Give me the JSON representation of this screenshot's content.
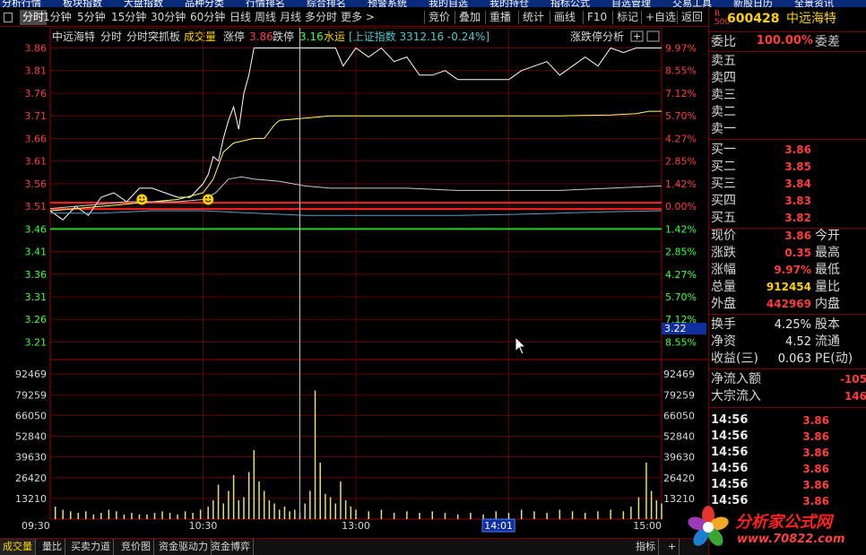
{
  "top_menu": [
    "分析行情",
    "板块指数",
    "大盘指数",
    "品种分类",
    "行情排名",
    "综合排名",
    "预警系统",
    "我的自选",
    "我的持仓",
    "指标公式",
    "自选管理",
    "交易工具",
    "新股日历",
    "全景资讯"
  ],
  "toolbar": {
    "periods": [
      "分时",
      "1分钟",
      "5分钟",
      "15分钟",
      "30分钟",
      "60分钟",
      "日线",
      "周线",
      "月线",
      "多分时",
      "更多 >"
    ],
    "actions": [
      "竞价",
      "叠加",
      "重播",
      "统计",
      "画线",
      "F10",
      "标记",
      "+自选",
      "返回"
    ]
  },
  "chart_header": {
    "name": "中远海特",
    "mode": "分时",
    "indicator": "分时突抓板",
    "vol_label": "成交量",
    "zt_label": "涨停",
    "zt_value": "3.86",
    "dt_label": "跌停",
    "dt_value": "3.16",
    "sector": "水运",
    "index_text": "[上证指数 3312.16 -0.24%]",
    "analysis_link": "涨跌停分析"
  },
  "chart_data": {
    "type": "line",
    "price_axis": [
      "3.86",
      "3.81",
      "3.76",
      "3.71",
      "3.66",
      "3.61",
      "3.56",
      "3.51",
      "3.46",
      "3.41",
      "3.36",
      "3.31",
      "3.26",
      "3.21"
    ],
    "pct_axis": [
      "9.97%",
      "8.55%",
      "7.12%",
      "5.70%",
      "4.27%",
      "2.85%",
      "1.42%",
      "0.00%",
      "1.42%",
      "2.85%",
      "4.27%",
      "5.70%",
      "7.12%",
      "8.55%"
    ],
    "vol_axis": [
      "92469",
      "79259",
      "66050",
      "52840",
      "39630",
      "26420",
      "13210"
    ],
    "time_axis": [
      "09:30",
      "10:30",
      "13:00",
      "14:01",
      "15:00"
    ],
    "cursor_price": "3.22",
    "cursor_time": "14:01",
    "prev_close": 3.51,
    "limit_down": 3.46,
    "ylim": [
      3.195,
      3.865
    ],
    "vol_ylim": [
      0,
      100000
    ],
    "series": [
      {
        "color": "#ffffff",
        "x": [
          0,
          5,
          10,
          15,
          20,
          25,
          30,
          35,
          40,
          45,
          50,
          55,
          60,
          62,
          64,
          66,
          68,
          70,
          72,
          74,
          76,
          78,
          80,
          82,
          84,
          86,
          88,
          90,
          95,
          100,
          105,
          110,
          112,
          115,
          120,
          125,
          130,
          135,
          140,
          145,
          150,
          155,
          160,
          165,
          170,
          175,
          180,
          185,
          190,
          195,
          200,
          205,
          210,
          215,
          220,
          225,
          230,
          235,
          240
        ],
        "y": [
          3.5,
          3.48,
          3.51,
          3.49,
          3.53,
          3.54,
          3.52,
          3.55,
          3.55,
          3.54,
          3.53,
          3.53,
          3.56,
          3.58,
          3.62,
          3.61,
          3.66,
          3.7,
          3.73,
          3.68,
          3.76,
          3.8,
          3.86,
          3.86,
          3.86,
          3.86,
          3.86,
          3.86,
          3.86,
          3.86,
          3.86,
          3.86,
          3.86,
          3.82,
          3.86,
          3.84,
          3.86,
          3.83,
          3.84,
          3.8,
          3.8,
          3.81,
          3.79,
          3.79,
          3.79,
          3.79,
          3.79,
          3.81,
          3.82,
          3.83,
          3.8,
          3.82,
          3.84,
          3.82,
          3.86,
          3.85,
          3.86,
          3.86,
          3.86
        ]
      },
      {
        "color": "#ffff60",
        "x": [
          0,
          10,
          20,
          30,
          40,
          50,
          60,
          64,
          68,
          72,
          76,
          80,
          84,
          88,
          90,
          100,
          110,
          120,
          140,
          160,
          180,
          200,
          220,
          230,
          235,
          240
        ],
        "y": [
          3.5,
          3.505,
          3.51,
          3.515,
          3.52,
          3.525,
          3.54,
          3.57,
          3.63,
          3.65,
          3.655,
          3.66,
          3.66,
          3.69,
          3.7,
          3.705,
          3.71,
          3.71,
          3.71,
          3.71,
          3.71,
          3.71,
          3.712,
          3.715,
          3.72,
          3.72
        ]
      },
      {
        "color": "#c8c8c8",
        "x": [
          0,
          10,
          20,
          30,
          40,
          50,
          60,
          65,
          70,
          75,
          80,
          90,
          100,
          110,
          120,
          140,
          160,
          180,
          200,
          220,
          240
        ],
        "y": [
          3.505,
          3.51,
          3.515,
          3.52,
          3.52,
          3.52,
          3.525,
          3.54,
          3.57,
          3.575,
          3.57,
          3.565,
          3.555,
          3.55,
          3.55,
          3.55,
          3.545,
          3.545,
          3.545,
          3.55,
          3.555
        ]
      },
      {
        "color": "#50a0c8",
        "x": [
          0,
          20,
          40,
          60,
          80,
          100,
          120,
          140,
          160,
          180,
          200,
          220,
          240
        ],
        "y": [
          3.495,
          3.495,
          3.5,
          3.5,
          3.495,
          3.49,
          3.49,
          3.49,
          3.49,
          3.492,
          3.495,
          3.498,
          3.5
        ]
      }
    ],
    "volume_bars": {
      "x": [
        2,
        5,
        8,
        11,
        14,
        17,
        20,
        23,
        26,
        29,
        32,
        35,
        38,
        41,
        44,
        47,
        50,
        53,
        56,
        59,
        62,
        64,
        66,
        68,
        70,
        72,
        74,
        76,
        78,
        80,
        82,
        84,
        86,
        88,
        90,
        92,
        94,
        96,
        98,
        100,
        102,
        104,
        106,
        108,
        110,
        112,
        114,
        116,
        118,
        120,
        125,
        130,
        135,
        140,
        145,
        150,
        155,
        160,
        165,
        170,
        175,
        180,
        185,
        190,
        195,
        200,
        205,
        210,
        215,
        220,
        225,
        228,
        231,
        234,
        236,
        238,
        240
      ],
      "y": [
        8000,
        6000,
        5000,
        4000,
        5000,
        3000,
        4000,
        6000,
        5000,
        3000,
        4000,
        3000,
        3000,
        4000,
        5000,
        4000,
        3000,
        5000,
        4000,
        6000,
        8000,
        12000,
        22000,
        10000,
        18000,
        28000,
        12000,
        14000,
        30000,
        44000,
        24000,
        18000,
        12000,
        10000,
        6000,
        8000,
        5000,
        6000,
        4000,
        10000,
        18000,
        82000,
        36000,
        16000,
        14000,
        10000,
        24000,
        12000,
        8000,
        6000,
        5000,
        6000,
        4000,
        5000,
        4000,
        5000,
        4000,
        3000,
        4000,
        3000,
        5000,
        4000,
        6000,
        5000,
        4000,
        6000,
        5000,
        4000,
        5000,
        6000,
        5000,
        8000,
        14000,
        36000,
        18000,
        12000,
        10000
      ]
    }
  },
  "quote": {
    "code": "600428",
    "name": "中远海特",
    "weibi_label": "委比",
    "weibi_value": "100.00%",
    "weicha_label": "委差",
    "asks": [
      {
        "label": "卖五",
        "price": ""
      },
      {
        "label": "卖四",
        "price": ""
      },
      {
        "label": "卖三",
        "price": ""
      },
      {
        "label": "卖二",
        "price": ""
      },
      {
        "label": "卖一",
        "price": ""
      }
    ],
    "bids": [
      {
        "label": "买一",
        "price": "3.86"
      },
      {
        "label": "买二",
        "price": "3.85"
      },
      {
        "label": "买三",
        "price": "3.84"
      },
      {
        "label": "买四",
        "price": "3.83"
      },
      {
        "label": "买五",
        "price": "3.82"
      }
    ],
    "stats": [
      {
        "l1": "现价",
        "v1": "3.86",
        "l2": "今开",
        "c": "red"
      },
      {
        "l1": "涨跌",
        "v1": "0.35",
        "l2": "最高",
        "c": "red"
      },
      {
        "l1": "涨幅",
        "v1": "9.97%",
        "l2": "最低",
        "c": "red"
      },
      {
        "l1": "总量",
        "v1": "912454",
        "l2": "量比",
        "c": "yel"
      },
      {
        "l1": "外盘",
        "v1": "442969",
        "l2": "内盘",
        "c": "red"
      }
    ],
    "stats2": [
      {
        "l1": "换手",
        "v1": "4.25%",
        "l2": "股本"
      },
      {
        "l1": "净资",
        "v1": "4.52",
        "l2": "流通"
      },
      {
        "l1": "收益(三)",
        "v1": "0.063",
        "l2": "PE(动)"
      }
    ],
    "flow": [
      {
        "label": "净流入额",
        "value": "-105"
      },
      {
        "label": "大宗流入",
        "value": "146"
      }
    ],
    "ticks": [
      {
        "time": "14:56",
        "price": "3.86"
      },
      {
        "time": "14:56",
        "price": "3.86"
      },
      {
        "time": "14:56",
        "price": "3.86"
      },
      {
        "time": "14:56",
        "price": "3.86"
      },
      {
        "time": "14:56",
        "price": "3.86"
      },
      {
        "time": "14:56",
        "price": "3.86"
      }
    ]
  },
  "bottom_tabs": [
    "成交量",
    "量比",
    "买卖力道",
    "竞价图",
    "资金驱动力",
    "资金博弈",
    "指标",
    "+"
  ],
  "watermark": {
    "name": "分析家公式网",
    "url": "www.70822.com"
  }
}
